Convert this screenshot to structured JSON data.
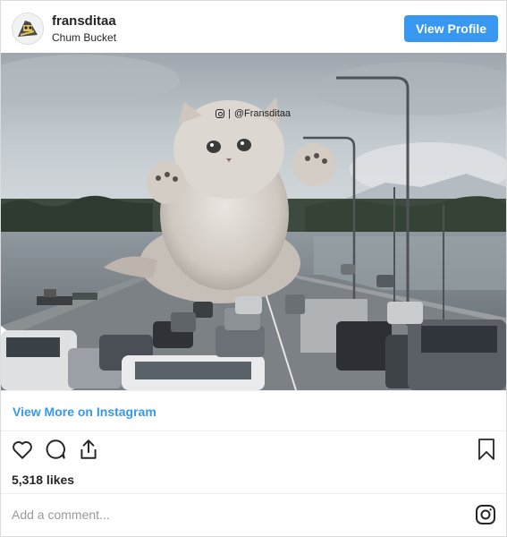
{
  "post": {
    "username": "fransditaa",
    "subtitle": "Chum Bucket",
    "view_profile_label": "View Profile",
    "watermark_handle": "@Fransditaa",
    "view_more_label": "View More on Instagram",
    "likes_text": "5,318 likes",
    "comment_placeholder": "Add a comment..."
  },
  "icons": {
    "like": "heart-icon",
    "comment": "comment-icon",
    "share": "share-icon",
    "save": "bookmark-icon",
    "instagram": "instagram-icon"
  },
  "colors": {
    "accent": "#3897f0",
    "text": "#262626",
    "muted": "#999999",
    "border": "#dbdbdb"
  }
}
